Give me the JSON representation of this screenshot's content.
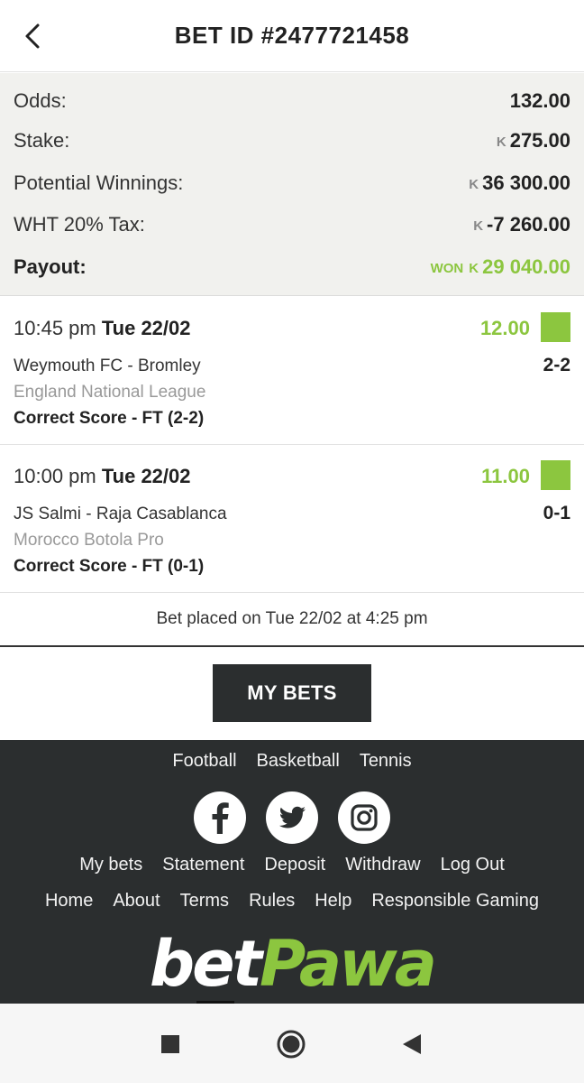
{
  "header": {
    "title": "BET ID #2477721458",
    "back_icon": "chevron-left-icon"
  },
  "summary": {
    "odds_label": "Odds:",
    "odds_value": "132.00",
    "stake_label": "Stake:",
    "stake_currency": "K",
    "stake_value": "275.00",
    "potential_label": "Potential Winnings:",
    "potential_currency": "K",
    "potential_value": "36 300.00",
    "tax_label": "WHT 20% Tax:",
    "tax_currency": "K",
    "tax_value": "-7 260.00",
    "payout_label": "Payout:",
    "payout_status": "WON",
    "payout_currency": "K",
    "payout_value": "29 040.00",
    "won_color": "#8cc63f"
  },
  "events": [
    {
      "time": "10:45 pm",
      "date": "Tue 22/02",
      "odds": "12.00",
      "teams": "Weymouth FC - Bromley",
      "score": "2-2",
      "league": "England National League",
      "market": "Correct Score  - FT (2-2)"
    },
    {
      "time": "10:00 pm",
      "date": "Tue 22/02",
      "odds": "11.00",
      "teams": "JS Salmi - Raja Casablanca",
      "score": "0-1",
      "league": "Morocco Botola Pro",
      "market": "Correct Score - FT (0-1)"
    }
  ],
  "placed": "Bet placed on Tue 22/02 at 4:25 pm",
  "my_bets_button": "MY BETS",
  "footer": {
    "sports": [
      "Football",
      "Basketball",
      "Tennis"
    ],
    "account_links": [
      "My bets",
      "Statement",
      "Deposit",
      "Withdraw",
      "Log Out"
    ],
    "info_links": [
      "Home",
      "About",
      "Terms",
      "Rules",
      "Help",
      "Responsible Gaming"
    ],
    "social_icons": [
      "facebook-icon",
      "twitter-icon",
      "instagram-icon"
    ],
    "logo_bet": "bet",
    "logo_pawa": "Pawa"
  },
  "navbar": {
    "icons": [
      "stop-square-icon",
      "home-circle-icon",
      "back-triangle-icon"
    ]
  }
}
